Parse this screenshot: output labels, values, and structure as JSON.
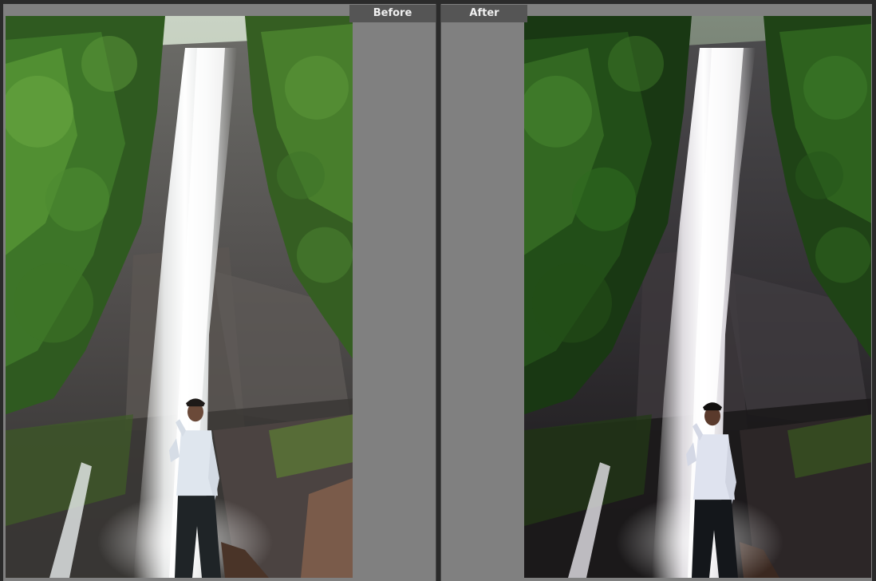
{
  "comparison": {
    "before_label": "Before",
    "after_label": "After"
  },
  "photo": {
    "subject": "waterfall-with-person"
  },
  "colors": {
    "background_panel": "#808080",
    "label_bg": "#555555",
    "label_text": "#f0f0f0",
    "divider": "#2a2a2a"
  }
}
